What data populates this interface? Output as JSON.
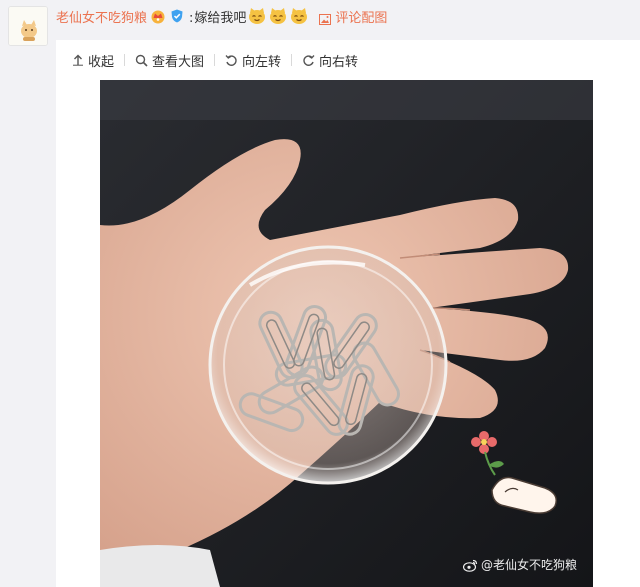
{
  "comment": {
    "username": "老仙女不吃狗粮",
    "colon": ":",
    "text": "嫁给我吧",
    "view_pic_label": "评论配图"
  },
  "toolbar": {
    "collapse": "收起",
    "view_large": "查看大图",
    "rotate_left": "向左转",
    "rotate_right": "向右转"
  },
  "image": {
    "watermark": "@老仙女不吃狗粮"
  },
  "colors": {
    "link": "#eb7350",
    "background": "#f2f2f5",
    "panel": "#ffffff"
  }
}
